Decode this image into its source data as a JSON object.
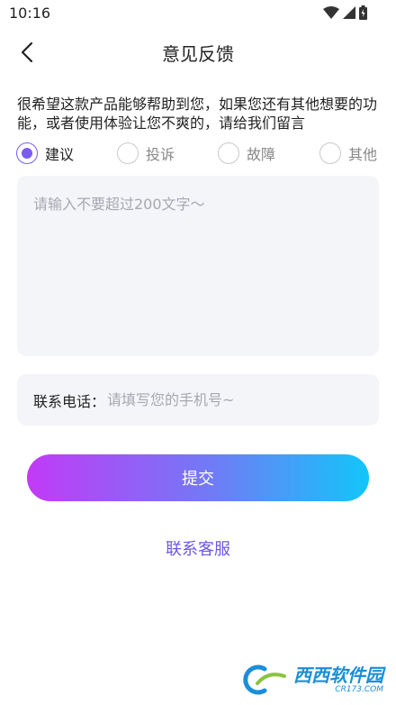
{
  "status_bar": {
    "time": "10:16"
  },
  "header": {
    "title": "意见反馈"
  },
  "intro": {
    "text": "很希望这款产品能够帮助到您，如果您还有其他想要的功能，或者使用体验让您不爽的，请给我们留言"
  },
  "feedback_types": [
    {
      "label": "建议",
      "selected": true
    },
    {
      "label": "投诉",
      "selected": false
    },
    {
      "label": "故障",
      "selected": false
    },
    {
      "label": "其他",
      "selected": false
    }
  ],
  "feedback": {
    "value": "",
    "placeholder": "请输入不要超过200文字～"
  },
  "phone": {
    "label": "联系电话：",
    "value": "",
    "placeholder": "请填写您的手机号~"
  },
  "submit": {
    "label": "提交"
  },
  "contact": {
    "label": "联系客服"
  },
  "colors": {
    "accent": "#7b5cf0",
    "link": "#6f56e8",
    "gradient_start": "#c23af7",
    "gradient_end": "#12c6f9",
    "field_bg": "#f4f5f9"
  },
  "watermark": {
    "text": "西西软件园",
    "sub": "CR173.COM"
  }
}
